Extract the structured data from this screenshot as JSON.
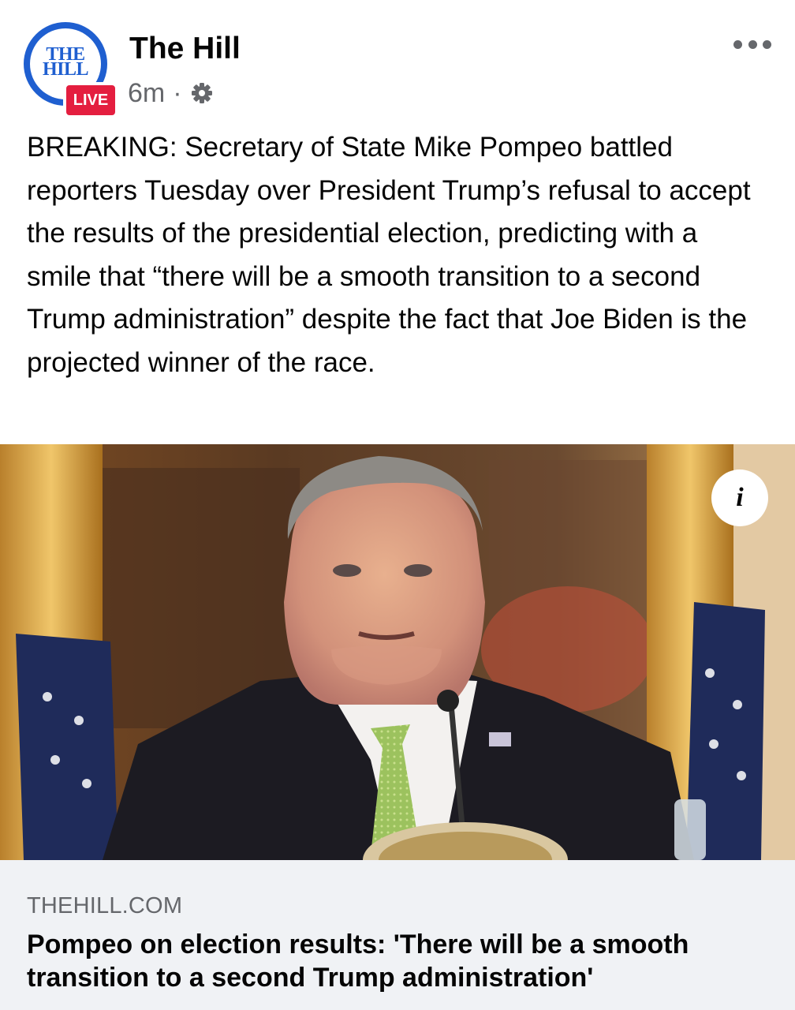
{
  "post": {
    "page_name": "The Hill",
    "avatar_text_line1": "THE",
    "avatar_text_line2": "HILL",
    "live_badge": "LIVE",
    "timestamp": "6m",
    "separator": "·",
    "audience_icon": "gear-icon",
    "menu_icon": "more-dots-icon",
    "text": "BREAKING: Secretary of State Mike Pompeo battled reporters Tuesday over President Trump’s refusal to accept the results of the presidential election, predicting with a smile that “there will be a smooth transition to a second Trump administration” despite the fact that Joe Biden is the projected winner of the race."
  },
  "media": {
    "info_label": "i"
  },
  "link": {
    "domain": "THEHILL.COM",
    "title": "Pompeo on election results: 'There will be a smooth transition to a second Trump administration'"
  },
  "colors": {
    "brand_blue": "#1f5fd0",
    "live_red": "#e41e3f",
    "secondary_text": "#65676b",
    "link_card_bg": "#f0f2f5"
  }
}
